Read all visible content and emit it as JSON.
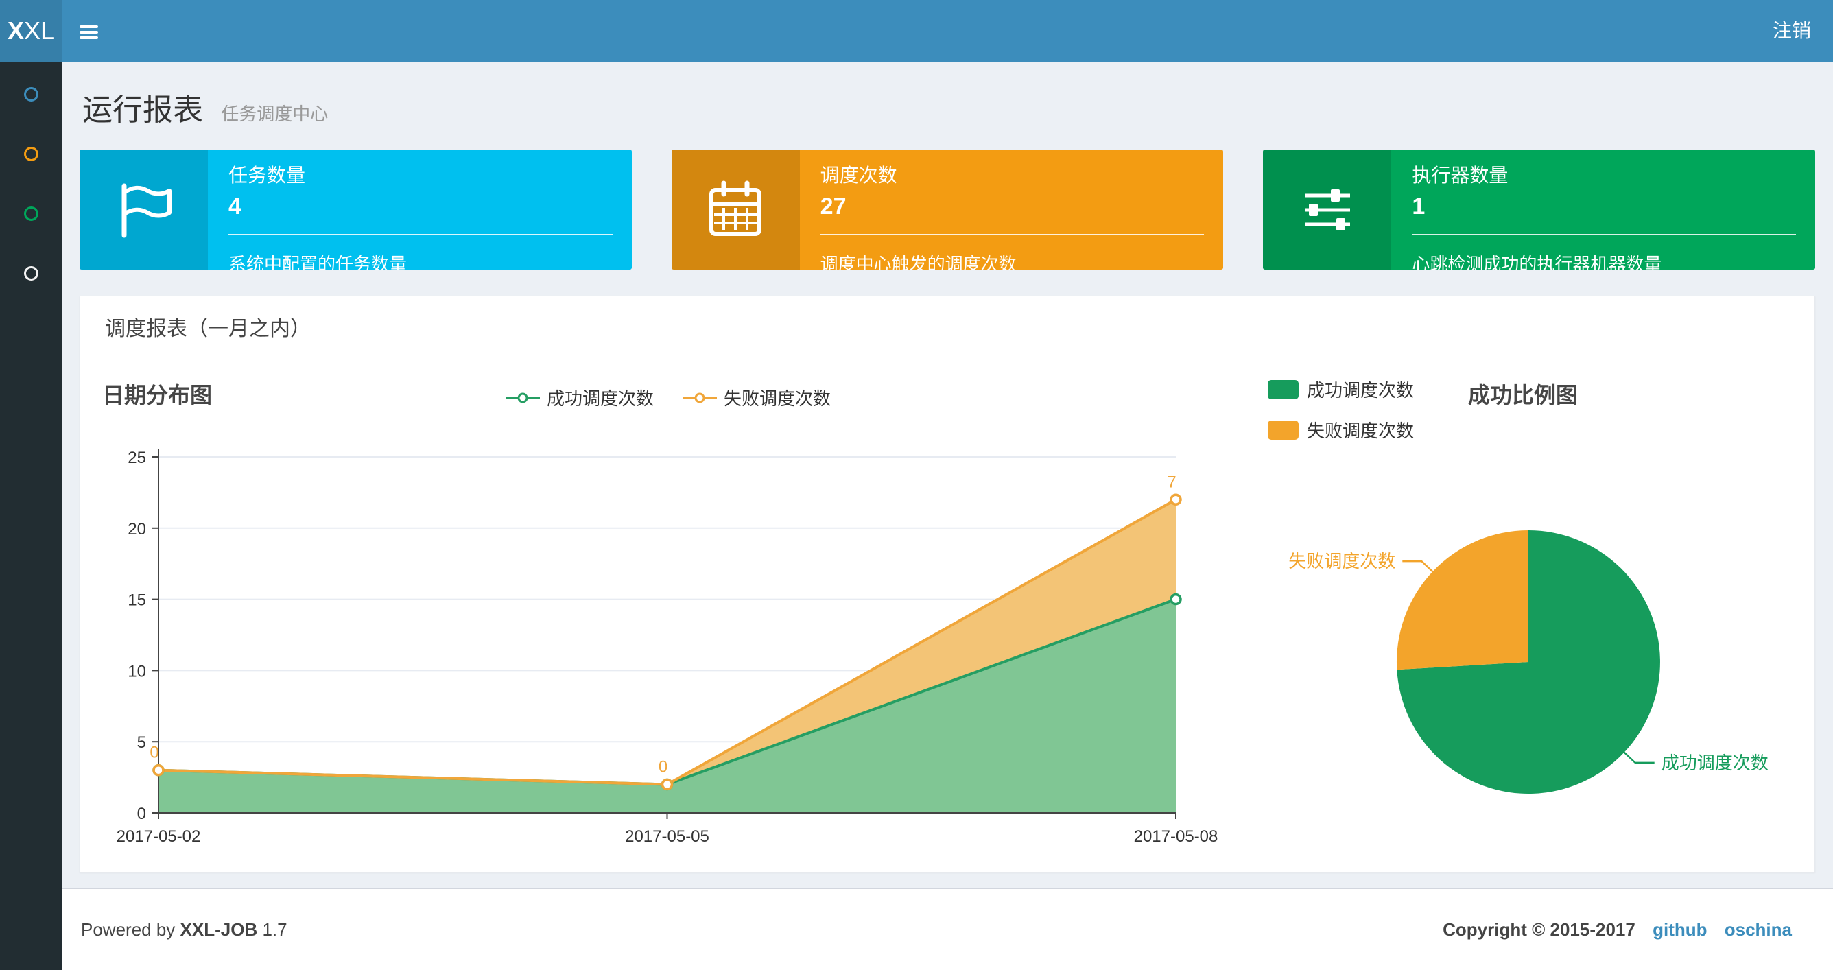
{
  "navbar": {
    "logo_bold": "X",
    "logo_light": "XL",
    "logout_label": "注销"
  },
  "sidebar": {
    "items": [
      {
        "icon": "circle-outline-icon",
        "color": "#3c8dbc"
      },
      {
        "icon": "circle-outline-icon",
        "color": "#f39c12"
      },
      {
        "icon": "circle-outline-icon",
        "color": "#00a65a"
      },
      {
        "icon": "circle-outline-icon",
        "color": "#f4f4f4"
      }
    ]
  },
  "header": {
    "title": "运行报表",
    "subtitle": "任务调度中心"
  },
  "info_boxes": [
    {
      "icon": "flag-icon",
      "title": "任务数量",
      "value": "4",
      "desc": "系统中配置的任务数量",
      "color": "#00c0ef"
    },
    {
      "icon": "calendar-icon",
      "title": "调度次数",
      "value": "27",
      "desc": "调度中心触发的调度次数",
      "color": "#f39c12"
    },
    {
      "icon": "sliders-icon",
      "title": "执行器数量",
      "value": "1",
      "desc": "心跳检测成功的执行器机器数量",
      "color": "#00a65a"
    }
  ],
  "panel": {
    "title": "调度报表（一月之内）"
  },
  "chart_data": [
    {
      "type": "area",
      "title": "日期分布图",
      "x": [
        "2017-05-02",
        "2017-05-05",
        "2017-05-08"
      ],
      "series": [
        {
          "name": "成功调度次数",
          "values": [
            3,
            2,
            15
          ],
          "color": "#259e63",
          "fill": "#80c694",
          "stack": true
        },
        {
          "name": "失败调度次数",
          "values": [
            0,
            0,
            7
          ],
          "color": "#f0a63a",
          "fill": "#f3c476",
          "stack": true,
          "labels": [
            "0",
            "0",
            "7"
          ]
        }
      ],
      "ylim": [
        0,
        25
      ],
      "yticks": [
        0,
        5,
        10,
        15,
        20,
        25
      ],
      "grid": true,
      "legend_position": "top"
    },
    {
      "type": "pie",
      "title": "成功比例图",
      "slices": [
        {
          "name": "成功调度次数",
          "value": 20,
          "color": "#169c5c"
        },
        {
          "name": "失败调度次数",
          "value": 7,
          "color": "#f3a42b"
        }
      ],
      "legend_position": "left"
    }
  ],
  "footer": {
    "powered_prefix": "Powered by",
    "brand": "XXL-JOB",
    "version": "1.7",
    "copyright": "Copyright © 2015-2017",
    "links": [
      {
        "label": "github"
      },
      {
        "label": "oschina"
      }
    ]
  }
}
